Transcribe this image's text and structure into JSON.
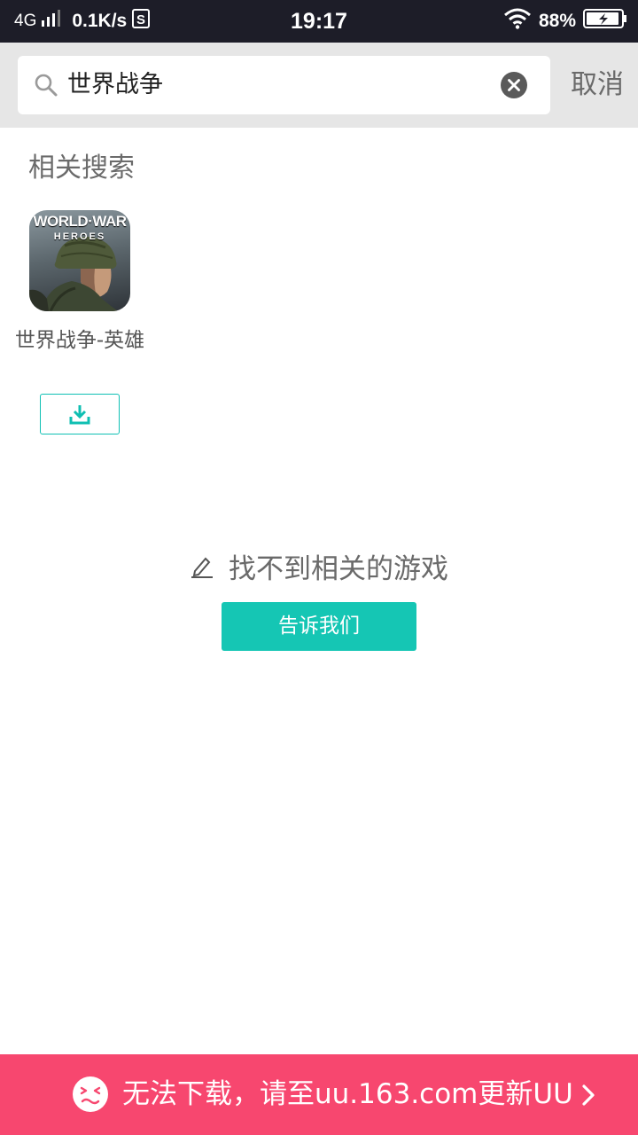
{
  "status_bar": {
    "network": "4G",
    "speed": "0.1K/s",
    "time": "19:17",
    "battery_percent": "88%"
  },
  "search": {
    "query": "世界战争",
    "cancel_label": "取消"
  },
  "related": {
    "title": "相关搜索",
    "items": [
      {
        "name": "世界战争-英雄",
        "logo_line1": "WORLD·WAR",
        "logo_line2": "HEROES",
        "icon": "download-icon"
      }
    ]
  },
  "empty_state": {
    "message": "找不到相关的游戏",
    "button_label": "告诉我们",
    "icon": "pencil-icon"
  },
  "banner": {
    "text": "无法下载，请至uu.163.com更新UU",
    "icon": "sad-face-icon",
    "accent_color": "#f7476f"
  },
  "colors": {
    "accent": "#15c6b4",
    "status_bar_bg": "#1d1d28",
    "header_bg": "#e6e6e6"
  }
}
